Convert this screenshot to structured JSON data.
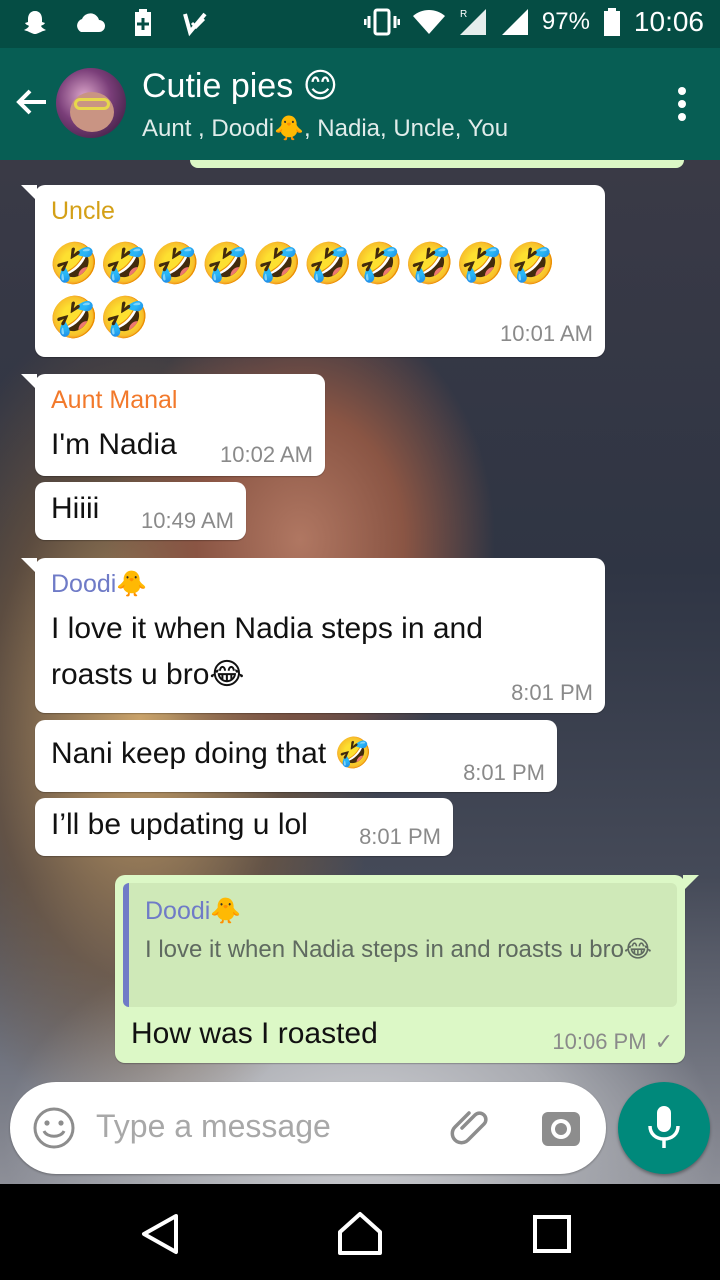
{
  "status_bar": {
    "battery": "97%",
    "time": "10:06",
    "icons": [
      "snapchat-icon",
      "cloud-icon",
      "battery-plus-icon",
      "check-icon",
      "vibrate-icon",
      "wifi-icon",
      "signal-roaming-icon",
      "signal-icon",
      "battery-icon"
    ]
  },
  "header": {
    "title": "Cutie pies 😊",
    "subtitle": "Aunt , Doodi🐥, Nadia, Uncle, You"
  },
  "messages": [
    {
      "sender": "Uncle",
      "sender_color": "#d4a017",
      "text_line1": "🤣🤣🤣🤣🤣🤣🤣🤣🤣🤣🤣",
      "text_line2": "🤣🤣",
      "time": "10:01 AM"
    },
    {
      "sender": "Aunt Manal",
      "sender_color": "#f2792b",
      "text": "I'm Nadia",
      "time": "10:02 AM"
    },
    {
      "text": "Hiiii",
      "time": "10:49 AM"
    },
    {
      "sender": "Doodi🐥",
      "sender_color": "#6f7bc7",
      "text_line1": "I love it when Nadia steps in and",
      "text_line2": "roasts u bro😂",
      "time": "8:01 PM"
    },
    {
      "text": "Nani keep doing that 🤣",
      "time": "8:01 PM"
    },
    {
      "text": "I’ll be updating u lol",
      "time": "8:01 PM"
    },
    {
      "quote_sender": "Doodi🐥",
      "quote_text": "I love it when Nadia steps in and roasts u bro😂",
      "text": "How was I roasted",
      "time": "10:06 PM",
      "status": "✓"
    }
  ],
  "composer": {
    "placeholder": "Type a message"
  },
  "colors": {
    "header": "#075e54",
    "status_bar": "#054d44",
    "outgoing_bubble": "#dcf8c6",
    "mic_button": "#00897b"
  }
}
